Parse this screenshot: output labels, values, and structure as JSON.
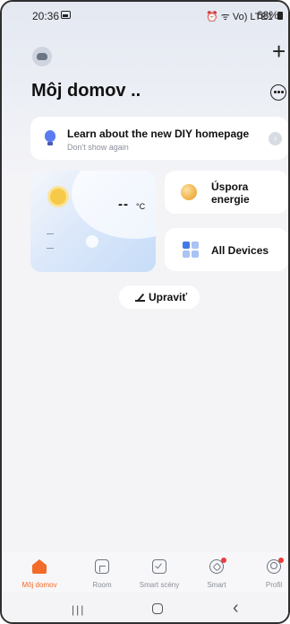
{
  "status_bar": {
    "time": "20:36",
    "signal_text": "Vo) LTE1",
    "battery": "68%"
  },
  "header": {
    "home_name": "Môj domov ..",
    "add_icon": "plus-icon",
    "more_icon": "more-circle-icon"
  },
  "banner": {
    "title": "Learn about the new DIY homepage",
    "subtitle": "Don't show again",
    "icon": "bulb-icon"
  },
  "weather": {
    "temperature": "--",
    "unit": "°C",
    "icon": "sun-icon"
  },
  "tiles": {
    "energy_label_1": "Úspora",
    "energy_label_2": "energie",
    "devices_label": "All Devices"
  },
  "edit_button": {
    "label": "Upraviť"
  },
  "tabbar": {
    "tabs": [
      {
        "label": "Môj domov",
        "icon": "home-icon",
        "active": true
      },
      {
        "label": "Room",
        "icon": "room-icon",
        "active": false
      },
      {
        "label": "Smart scény",
        "icon": "scene-icon",
        "active": false
      },
      {
        "label": "Smart",
        "icon": "smart-icon",
        "active": false
      },
      {
        "label": "Profil",
        "icon": "profile-icon",
        "active": false
      }
    ]
  },
  "colors": {
    "accent": "#f26b2a",
    "notification_dot": "#ee3b3b",
    "bulb": "#5b7cf0"
  }
}
